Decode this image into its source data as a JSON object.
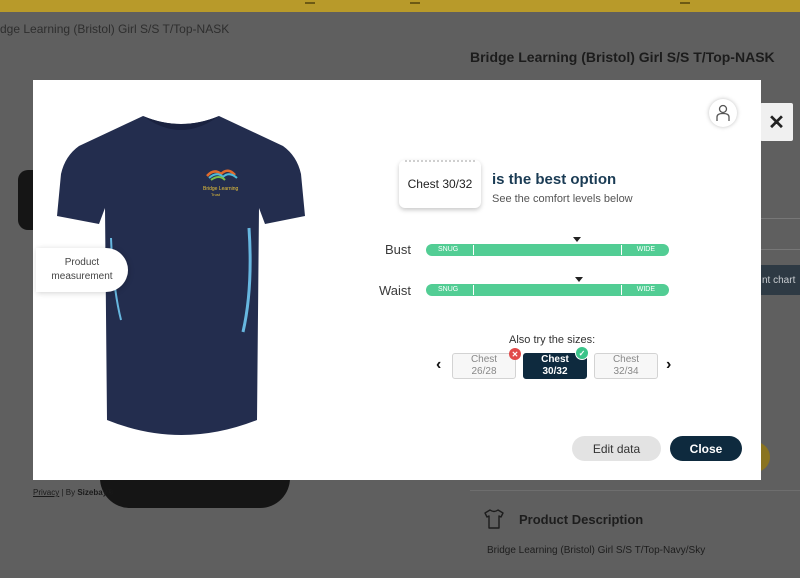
{
  "page": {
    "breadcrumb": "dge Learning (Bristol) Girl S/S T/Top-NASK",
    "product_title": "Bridge Learning (Bristol) Girl S/S T/Top-NASK",
    "size_chart_button_partial": "nt chart",
    "product_description_title": "Product Description",
    "product_description_text": "Bridge Learning (Bristol) Girl S/S T/Top-Navy/Sky",
    "privacy_link": "Privacy",
    "by_label": "| By",
    "sizebay_brand": "Sizebay®"
  },
  "modal": {
    "product_measurement_line1": "Product",
    "product_measurement_line2": "measurement",
    "recommended_size": "Chest 30/32",
    "best_option_text": "is the best option",
    "comfort_hint": "See the comfort levels below",
    "fit_rows": [
      {
        "label": "Bust",
        "snug_label": "SNUG",
        "wide_label": "WIDE",
        "marker_fraction": 0.62
      },
      {
        "label": "Waist",
        "snug_label": "SNUG",
        "wide_label": "WIDE",
        "marker_fraction": 0.63
      }
    ],
    "also_try_label": "Also try the sizes:",
    "prev_arrow": "‹",
    "next_arrow": "›",
    "sizes": [
      {
        "line1": "Chest",
        "line2": "26/28",
        "status": "not-recommended"
      },
      {
        "line1": "Chest",
        "line2": "30/32",
        "status": "recommended"
      },
      {
        "line1": "Chest",
        "line2": "32/34",
        "status": "none"
      }
    ],
    "edit_button": "Edit data",
    "close_button": "Close",
    "logo_text_line1": "Bridge Learning",
    "logo_text_line2": "Trust"
  },
  "colors": {
    "navy": "#0e2a3e",
    "fit_green": "#52cd94",
    "title_blue": "#1a3b54",
    "shirt_navy": "#232d4e",
    "shirt_accent": "#67b7e0"
  },
  "icons": [
    "close-icon",
    "user-icon",
    "tshirt-icon",
    "chevron-left-icon",
    "chevron-right-icon",
    "x-badge-icon",
    "check-badge-icon"
  ]
}
